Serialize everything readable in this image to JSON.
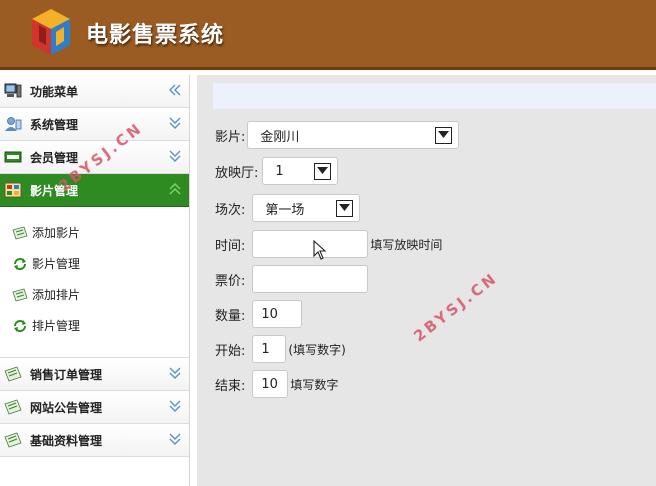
{
  "header": {
    "title": "电影售票系统"
  },
  "sidebar": {
    "items": [
      {
        "label": "功能菜单",
        "icon": "computer-icon"
      },
      {
        "label": "系统管理",
        "icon": "person-icon"
      },
      {
        "label": "会员管理",
        "icon": "card-icon"
      },
      {
        "label": "影片管理",
        "icon": "film-icon"
      }
    ],
    "submenu": [
      {
        "label": "添加影片",
        "icon": "add-note-icon"
      },
      {
        "label": "影片管理",
        "icon": "refresh-icon"
      },
      {
        "label": "添加排片",
        "icon": "add-note-icon"
      },
      {
        "label": "排片管理",
        "icon": "refresh-icon"
      }
    ],
    "items_after": [
      {
        "label": "销售订单管理",
        "icon": "note-icon"
      },
      {
        "label": "网站公告管理",
        "icon": "note-icon"
      },
      {
        "label": "基础资料管理",
        "icon": "note-icon"
      }
    ]
  },
  "form": {
    "movie_label": "影片:",
    "movie_value": "金刚川",
    "hall_label": "放映厅:",
    "hall_value": "1",
    "session_label": "场次:",
    "session_value": "第一场",
    "time_label": "时间:",
    "time_value": "",
    "time_hint": "填写放映时间",
    "price_label": "票价:",
    "price_value": "",
    "quantity_label": "数量:",
    "quantity_value": "10",
    "start_label": "开始:",
    "start_value": "1",
    "start_hint": "(填写数字)",
    "end_label": "结束:",
    "end_value": "10",
    "end_hint": "填写数字"
  },
  "watermark": {
    "text": "2BYSJ.CN"
  },
  "colors": {
    "header_bg": "#9a5c22",
    "active_menu": "#2e8b22",
    "watermark": "#d7556a"
  }
}
